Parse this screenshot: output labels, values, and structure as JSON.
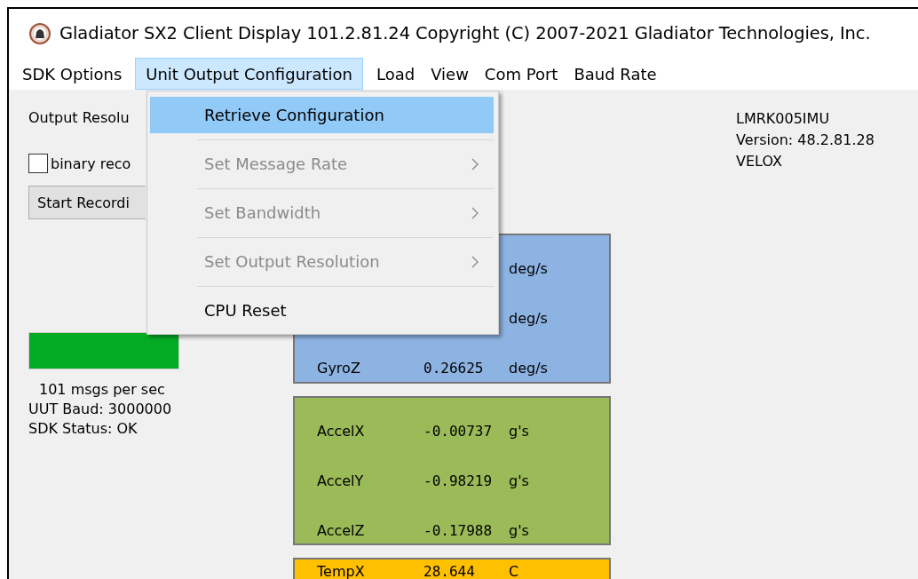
{
  "window": {
    "title": "Gladiator SX2 Client Display 101.2.81.24 Copyright (C) 2007-2021 Gladiator Technologies, Inc."
  },
  "menu_bar": [
    {
      "label": "SDK Options",
      "selected": false
    },
    {
      "label": "Unit Output Configuration",
      "selected": true
    },
    {
      "label": "Load",
      "selected": false
    },
    {
      "label": "View",
      "selected": false
    },
    {
      "label": "Com Port",
      "selected": false
    },
    {
      "label": "Baud Rate",
      "selected": false
    }
  ],
  "dropdown": [
    {
      "label": "Retrieve Configuration",
      "selected": true,
      "disabled": false,
      "submenu": false
    },
    {
      "label": "Set Message Rate",
      "selected": false,
      "disabled": true,
      "submenu": true
    },
    {
      "label": "Set Bandwidth",
      "selected": false,
      "disabled": true,
      "submenu": true
    },
    {
      "label": "Set Output Resolution",
      "selected": false,
      "disabled": true,
      "submenu": true
    },
    {
      "label": "CPU Reset",
      "selected": false,
      "disabled": false,
      "submenu": false
    }
  ],
  "left_panel": {
    "output_resolution_label": "Output Resolu",
    "binary_record": {
      "label": "binary reco",
      "checked": false
    },
    "record_button": "Start Recordi",
    "rate": "101 msgs per sec",
    "baud": "UUT Baud: 3000000",
    "sdk_status": "SDK Status: OK"
  },
  "device_info": [
    "LMRK005IMU",
    "Version: 48.2.81.28",
    "VELOX"
  ],
  "sensor_groups": [
    {
      "color": "#8db3e2",
      "rows": [
        {
          "unit": "deg/s"
        },
        {
          "unit": "deg/s"
        },
        {
          "label": "GyroZ",
          "value": "0.26625",
          "unit": "deg/s"
        }
      ]
    },
    {
      "color": "#9bbb59",
      "rows": [
        {
          "label": "AccelX",
          "value": "-0.00737",
          "unit": "g's"
        },
        {
          "label": "AccelY",
          "value": "-0.98219",
          "unit": "g's"
        },
        {
          "label": "AccelZ",
          "value": "-0.17988",
          "unit": "g's"
        }
      ]
    },
    {
      "color": "#ffc000",
      "rows": [
        {
          "label": "TempX",
          "value": "28.644",
          "unit": "C"
        }
      ]
    }
  ]
}
